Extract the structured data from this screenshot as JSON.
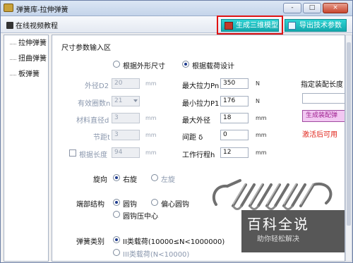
{
  "window": {
    "title": "弹簧库-拉伸弹簧",
    "btn_min": "-",
    "btn_max": "□",
    "btn_close": "×"
  },
  "toolbar": {
    "video_tutorial": "在线视频教程",
    "generate_3d": "生成三维模型",
    "export_params": "导出技术参数"
  },
  "sidebar": {
    "items": [
      {
        "label": "拉伸弹簧"
      },
      {
        "label": "扭曲弹簧"
      },
      {
        "label": "板弹簧"
      }
    ]
  },
  "panel": {
    "section_title": "尺寸参数输入区",
    "mode_shape": "根据外形尺寸",
    "mode_load": "根据载荷设计",
    "left": {
      "outer_d2_label": "外径D2",
      "outer_d2_value": "20",
      "outer_d2_unit": "mm",
      "coils_label": "有效圈数n",
      "coils_value": "21",
      "wire_d_label": "材料直径d",
      "wire_d_value": "3",
      "wire_d_unit": "mm",
      "pitch_label": "节距t",
      "pitch_value": "3",
      "pitch_unit": "mm",
      "by_length_label": "根据长度",
      "by_length_value": "94",
      "by_length_unit": "mm"
    },
    "right": {
      "fmax_label": "最大拉力Pn",
      "fmax_value": "350",
      "fmax_unit": "N",
      "fmin_label": "最小拉力P1",
      "fmin_value": "176",
      "fmin_unit": "N",
      "outer_max_label": "最大外径",
      "outer_max_value": "18",
      "outer_max_unit": "mm",
      "gap_label": "间距 δ",
      "gap_value": "0",
      "gap_unit": "mm",
      "stroke_label": "工作行程h",
      "stroke_value": "12",
      "stroke_unit": "mm"
    },
    "assembly_length_label": "指定装配长度",
    "generate_assembly": "生成装配弹",
    "activate_note": "激活后可用",
    "rotation_label": "旋向",
    "rotation_right": "右旋",
    "rotation_left": "左旋",
    "end_label": "端部结构",
    "end_hook": "圆钩",
    "end_offset_hook": "偏心圆钩",
    "end_center_hook": "圆钩压中心",
    "class_label": "弹簧类别",
    "class_2": "II类载荷(10000≤N<1000000)",
    "class_3": "III类载荷(N<10000)"
  },
  "watermark": {
    "big": "百科全说",
    "small": "助你轻松解决"
  },
  "colors": {
    "accent_teal": "#12a8ad",
    "highlight_red": "#e01313",
    "activate_red": "#e0241a"
  }
}
